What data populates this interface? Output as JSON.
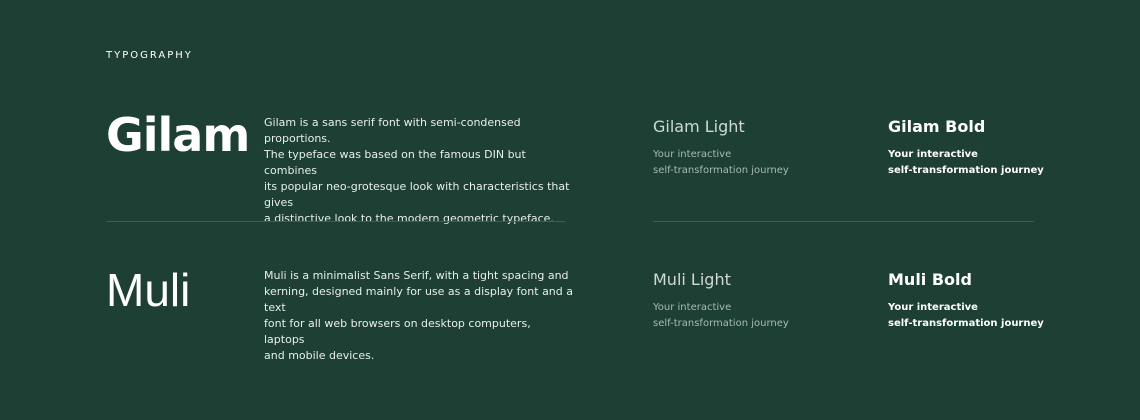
{
  "section_label": "TYPOGRAPHY",
  "fonts": [
    {
      "name": "Gilam",
      "description": [
        "Gilam is a sans serif font with semi-condensed proportions.",
        "The typeface was based on the famous DIN but combines",
        "its popular neo-grotesque look with characteristics that gives",
        "a distinctive look to the modern geometric typeface."
      ],
      "light_label": "Gilam Light",
      "bold_label": "Gilam Bold",
      "sample_lines": [
        "Your interactive",
        "self-transformation journey"
      ]
    },
    {
      "name": "Muli",
      "description": [
        "Muli is a minimalist Sans Serif,  with a tight spacing and",
        "kerning, designed mainly for use as a display font and a text",
        "font for all web browsers on desktop computers, laptops",
        "and mobile devices."
      ],
      "light_label": "Muli Light",
      "bold_label": "Muli Bold",
      "sample_lines": [
        "Your interactive",
        "self-transformation journey"
      ]
    }
  ],
  "colors": {
    "background": "#1e3f34",
    "divider": "#3f5e52",
    "text_primary": "#ffffff",
    "text_muted": "#a9bbb2"
  }
}
